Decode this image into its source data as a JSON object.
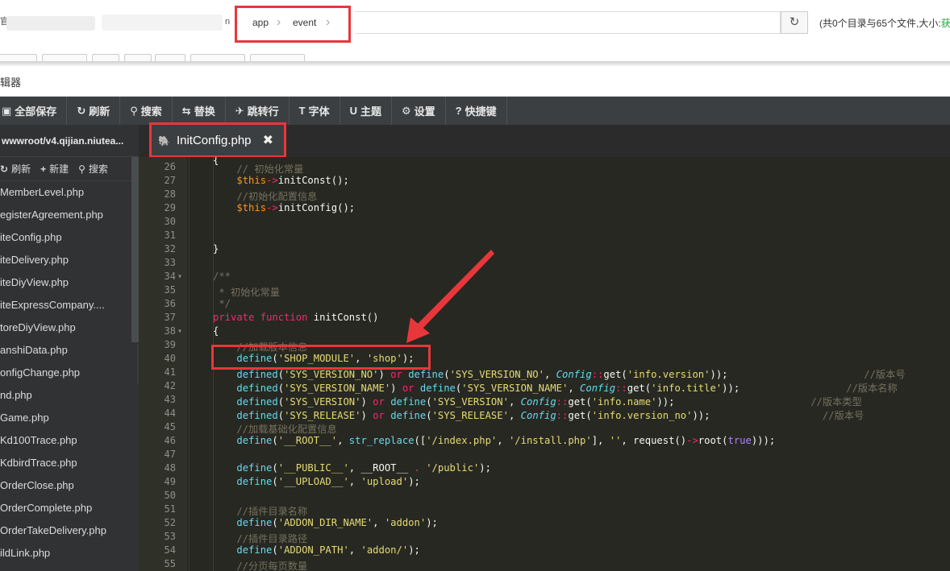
{
  "pathbar": {
    "edge_char": "官",
    "edge_char2": "n",
    "crumbs": [
      "app",
      "event"
    ],
    "summary_prefix": "(共0个目录与65个文件,大小:",
    "summary_link": "获"
  },
  "editor_title": "编辑器",
  "toolbar": [
    {
      "icon": "save-icon",
      "glyph": "▣",
      "label": "全部保存"
    },
    {
      "icon": "refresh-icon",
      "glyph": "↻",
      "label": "刷新"
    },
    {
      "icon": "search-icon",
      "glyph": "⚲",
      "label": "搜索"
    },
    {
      "icon": "replace-icon",
      "glyph": "⇆",
      "label": "替换"
    },
    {
      "icon": "jump-icon",
      "glyph": "✈",
      "label": "跳转行"
    },
    {
      "icon": "font-icon",
      "glyph": "T",
      "label": "字体"
    },
    {
      "icon": "theme-icon",
      "glyph": "U",
      "label": "主题"
    },
    {
      "icon": "gear-icon",
      "glyph": "⚙",
      "label": "设置"
    },
    {
      "icon": "question-icon",
      "glyph": "?",
      "label": "快捷键"
    }
  ],
  "sidebar": {
    "path": "wwwroot/v4.qijian.niutea...",
    "actions": [
      {
        "icon": "refresh-icon",
        "glyph": "↻",
        "label": "刷新"
      },
      {
        "icon": "plus-icon",
        "glyph": "+",
        "label": "新建"
      },
      {
        "icon": "search-icon",
        "glyph": "⚲",
        "label": "搜索"
      }
    ],
    "files": [
      "MemberLevel.php",
      "egisterAgreement.php",
      "iteConfig.php",
      "iteDelivery.php",
      "iteDiyView.php",
      "iteExpressCompany....",
      "toreDiyView.php",
      "anshiData.php",
      "onfigChange.php",
      "nd.php",
      "Game.php",
      "Kd100Trace.php",
      "KdbirdTrace.php",
      "OrderClose.php",
      "OrderComplete.php",
      "OrderTakeDelivery.php",
      "ildLink.php"
    ]
  },
  "tab": {
    "filename": "InitConfig.php",
    "close_glyph": "✖"
  },
  "editor": {
    "line_numbers": [
      26,
      27,
      28,
      29,
      30,
      31,
      32,
      33,
      34,
      35,
      36,
      37,
      38,
      39,
      40,
      41,
      42,
      43,
      44,
      45,
      46,
      47,
      48,
      49,
      50,
      51,
      52,
      53,
      54,
      55
    ],
    "fold_lines": [
      34,
      38
    ],
    "fold_glyph": "▾"
  },
  "colors": {
    "highlight": "#e8373a",
    "editor_bg": "#272822",
    "toolbar_bg": "#3c3f41",
    "sidebar_bg": "#303234",
    "summary_link": "#20a53a"
  }
}
